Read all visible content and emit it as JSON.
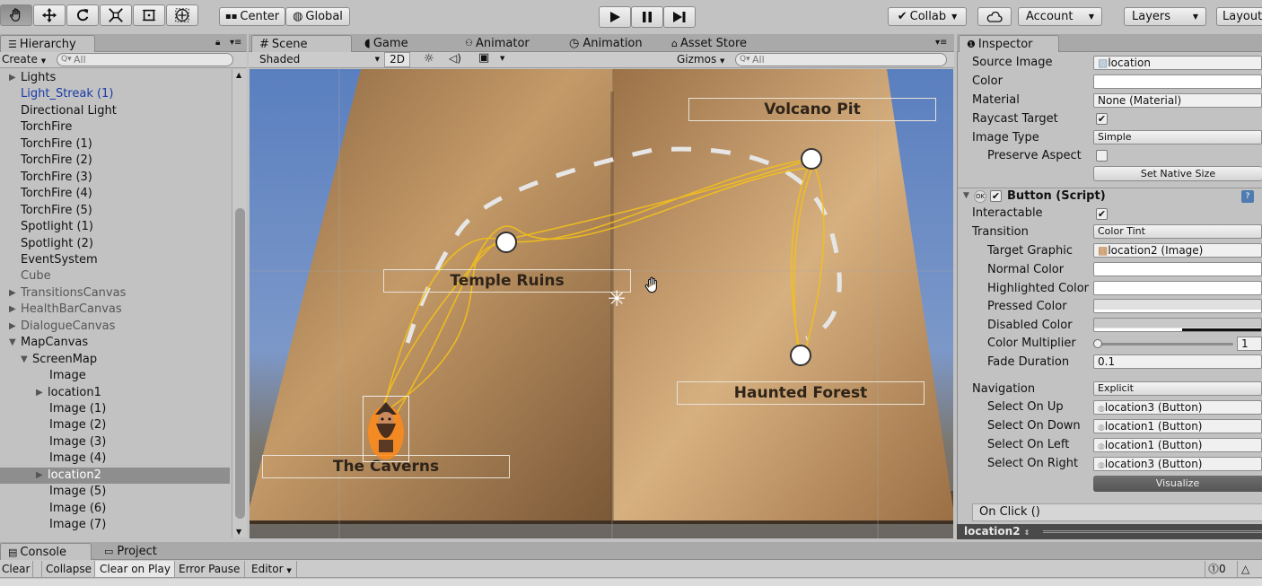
{
  "toolbar": {
    "tools": [
      "hand-tool-icon",
      "move-tool-icon",
      "rotate-tool-icon",
      "scale-tool-icon",
      "rect-tool-icon",
      "transform-tool-icon"
    ],
    "pivot": "Center",
    "space": "Global",
    "collab": "Collab",
    "account": "Account",
    "layers": "Layers",
    "layout": "Layout"
  },
  "hierarchy": {
    "tab": "Hierarchy",
    "create": "Create",
    "search_placeholder": "All",
    "items": [
      {
        "label": "Lights",
        "indent": 0,
        "arrow": "right",
        "style": "normal"
      },
      {
        "label": "Light_Streak (1)",
        "indent": 1,
        "arrow": "",
        "style": "link"
      },
      {
        "label": "Directional Light",
        "indent": 1,
        "arrow": "",
        "style": "normal"
      },
      {
        "label": "TorchFire",
        "indent": 1,
        "arrow": "",
        "style": "normal"
      },
      {
        "label": "TorchFire (1)",
        "indent": 1,
        "arrow": "",
        "style": "normal"
      },
      {
        "label": "TorchFire (2)",
        "indent": 1,
        "arrow": "",
        "style": "normal"
      },
      {
        "label": "TorchFire (3)",
        "indent": 1,
        "arrow": "",
        "style": "normal"
      },
      {
        "label": "TorchFire (4)",
        "indent": 1,
        "arrow": "",
        "style": "normal"
      },
      {
        "label": "TorchFire (5)",
        "indent": 1,
        "arrow": "",
        "style": "normal"
      },
      {
        "label": "Spotlight (1)",
        "indent": 1,
        "arrow": "",
        "style": "normal"
      },
      {
        "label": "Spotlight (2)",
        "indent": 1,
        "arrow": "",
        "style": "normal"
      },
      {
        "label": "EventSystem",
        "indent": 1,
        "arrow": "",
        "style": "normal"
      },
      {
        "label": "Cube",
        "indent": 1,
        "arrow": "",
        "style": "dim"
      },
      {
        "label": "TransitionsCanvas",
        "indent": 0,
        "arrow": "right",
        "style": "dim"
      },
      {
        "label": "HealthBarCanvas",
        "indent": 0,
        "arrow": "right",
        "style": "dim"
      },
      {
        "label": "DialogueCanvas",
        "indent": 0,
        "arrow": "right",
        "style": "dim"
      },
      {
        "label": "MapCanvas",
        "indent": 0,
        "arrow": "down",
        "style": "normal"
      },
      {
        "label": "ScreenMap",
        "indent": 1,
        "arrow": "down",
        "style": "normal"
      },
      {
        "label": "Image",
        "indent": 3,
        "arrow": "",
        "style": "normal"
      },
      {
        "label": "location1",
        "indent": 2,
        "arrow": "right",
        "style": "normal"
      },
      {
        "label": "Image (1)",
        "indent": 3,
        "arrow": "",
        "style": "normal"
      },
      {
        "label": "Image (2)",
        "indent": 3,
        "arrow": "",
        "style": "normal"
      },
      {
        "label": "Image (3)",
        "indent": 3,
        "arrow": "",
        "style": "normal"
      },
      {
        "label": "Image (4)",
        "indent": 3,
        "arrow": "",
        "style": "normal"
      },
      {
        "label": "location2",
        "indent": 2,
        "arrow": "right",
        "style": "selected"
      },
      {
        "label": "Image (5)",
        "indent": 3,
        "arrow": "",
        "style": "normal"
      },
      {
        "label": "Image (6)",
        "indent": 3,
        "arrow": "",
        "style": "normal"
      },
      {
        "label": "Image (7)",
        "indent": 3,
        "arrow": "",
        "style": "normal"
      }
    ]
  },
  "scene": {
    "tabs": [
      "Scene",
      "Game",
      "Animator",
      "Animation",
      "Asset Store"
    ],
    "shading": "Shaded",
    "mode2d": "2D",
    "gizmos": "Gizmos",
    "search_placeholder": "All",
    "locations": {
      "volcano": "Volcano Pit",
      "temple": "Temple Ruins",
      "forest": "Haunted Forest",
      "caverns": "The Caverns"
    }
  },
  "inspector": {
    "tab": "Inspector",
    "image": {
      "source_image_label": "Source Image",
      "source_image_value": "location",
      "color_label": "Color",
      "material_label": "Material",
      "material_value": "None (Material)",
      "raycast_label": "Raycast Target",
      "image_type_label": "Image Type",
      "image_type_value": "Simple",
      "preserve_label": "Preserve Aspect",
      "native_size": "Set Native Size"
    },
    "button": {
      "header": "Button (Script)",
      "interactable_label": "Interactable",
      "transition_label": "Transition",
      "transition_value": "Color Tint",
      "target_graphic_label": "Target Graphic",
      "target_graphic_value": "location2 (Image)",
      "normal_label": "Normal Color",
      "highlighted_label": "Highlighted Color",
      "pressed_label": "Pressed Color",
      "disabled_label": "Disabled Color",
      "multiplier_label": "Color Multiplier",
      "multiplier_value": "1",
      "fade_label": "Fade Duration",
      "fade_value": "0.1",
      "navigation_label": "Navigation",
      "navigation_value": "Explicit",
      "up_label": "Select On Up",
      "up_value": "location3 (Button)",
      "down_label": "Select On Down",
      "down_value": "location1 (Button)",
      "left_label": "Select On Left",
      "left_value": "location1 (Button)",
      "right_label": "Select On Right",
      "right_value": "location3 (Button)",
      "visualize": "Visualize",
      "onclick": "On Click ()"
    },
    "footer": "location2"
  },
  "console": {
    "tabs": [
      "Console",
      "Project"
    ],
    "buttons": [
      "Clear",
      "Collapse",
      "Clear on Play",
      "Error Pause",
      "Editor"
    ],
    "count": "0"
  }
}
